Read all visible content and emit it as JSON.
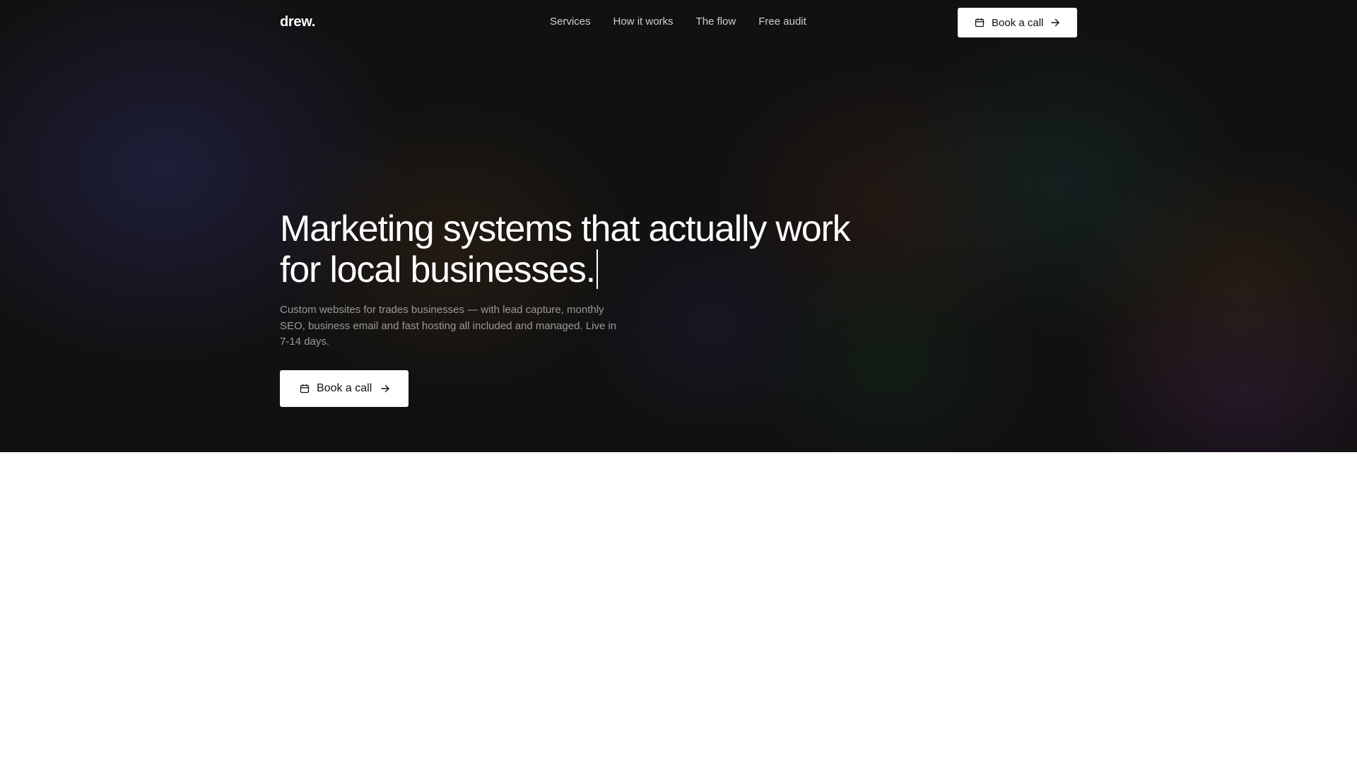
{
  "nav": {
    "logo": "drew.",
    "links": [
      "Services",
      "How it works",
      "The flow",
      "Free audit"
    ],
    "cta_label": "Book a call"
  },
  "hero": {
    "headline_line1": "Marketing systems that actually work",
    "headline_line2": "for local businesses.",
    "subtext": "Custom websites for trades businesses — with lead capture, monthly SEO, business email and fast hosting all included and managed. Live in 7-14 days.",
    "cta_label": "Book a call"
  },
  "icons": {
    "calendar": "calendar-icon",
    "arrow": "arrow-right-icon"
  },
  "colors": {
    "hero_background": "#111111",
    "button_background": "#ffffff",
    "button_text": "#111111",
    "subtext": "#9a9a9a",
    "page_background": "#ffffff"
  }
}
